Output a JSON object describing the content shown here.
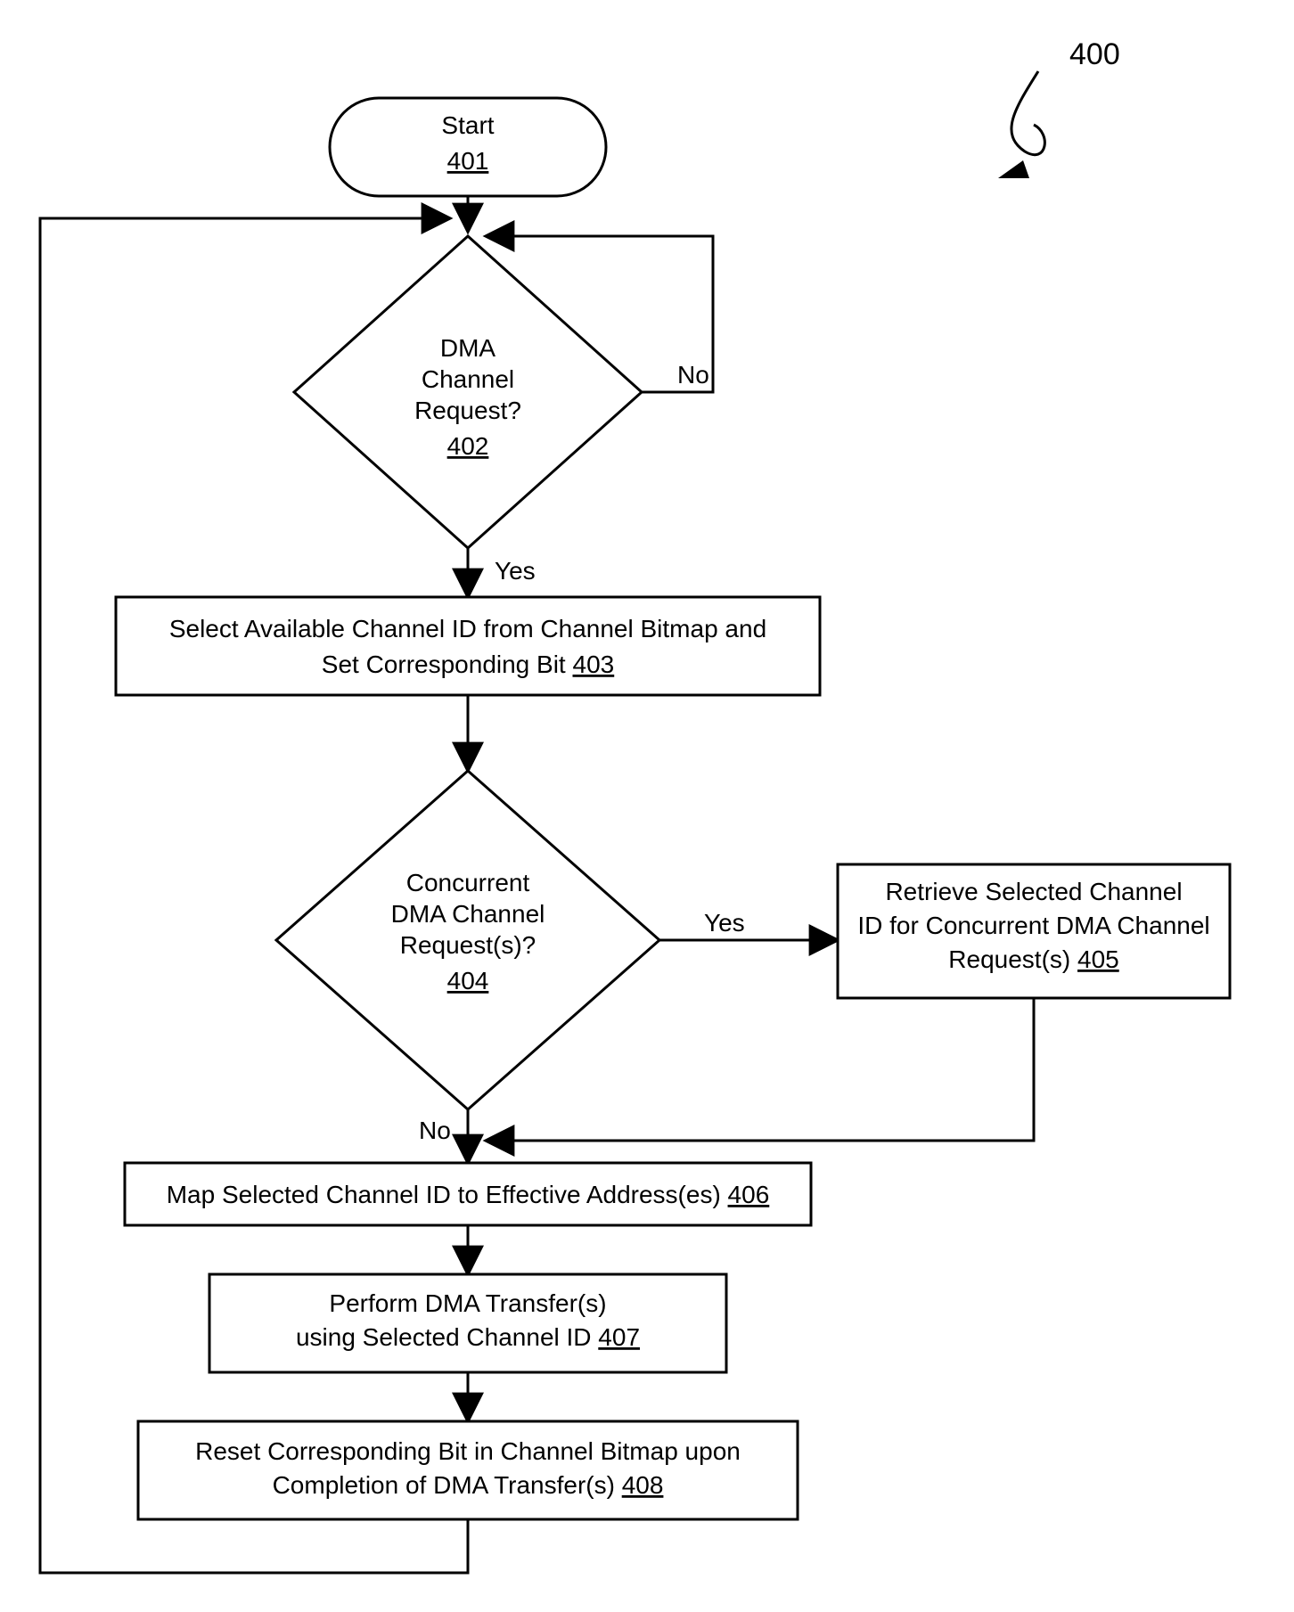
{
  "figure_number": "400",
  "nodes": {
    "start": {
      "label": "Start",
      "ref": "401"
    },
    "d402": {
      "line1": "DMA",
      "line2": "Channel",
      "line3": "Request?",
      "ref": "402"
    },
    "b403": {
      "line1": "Select Available Channel ID from Channel Bitmap and",
      "line2_pre": "Set Corresponding Bit ",
      "ref": "403"
    },
    "d404": {
      "line1": "Concurrent",
      "line2": "DMA Channel",
      "line3": "Request(s)?",
      "ref": "404"
    },
    "b405": {
      "line1": "Retrieve Selected Channel",
      "line2": "ID for Concurrent DMA Channel",
      "line3_pre": "Request(s) ",
      "ref": "405"
    },
    "b406": {
      "line1_pre": "Map Selected Channel ID to Effective Address(es) ",
      "ref": "406"
    },
    "b407": {
      "line1": "Perform DMA Transfer(s)",
      "line2_pre": "using Selected Channel ID ",
      "ref": "407"
    },
    "b408": {
      "line1": "Reset Corresponding Bit in Channel Bitmap upon",
      "line2_pre": "Completion of DMA Transfer(s) ",
      "ref": "408"
    }
  },
  "edges": {
    "yes": "Yes",
    "no": "No"
  }
}
